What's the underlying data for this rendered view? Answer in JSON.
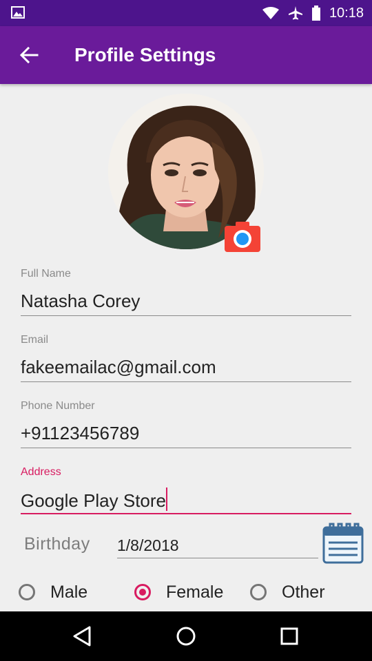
{
  "status_bar": {
    "time": "10:18",
    "icons": [
      "image-icon",
      "wifi-icon",
      "airplane-icon",
      "battery-icon"
    ]
  },
  "app_bar": {
    "title": "Profile Settings",
    "back_icon": "arrow-back-icon"
  },
  "profile": {
    "camera_icon": "camera-icon"
  },
  "form": {
    "full_name": {
      "label": "Full Name",
      "value": "Natasha Corey"
    },
    "email": {
      "label": "Email",
      "value": "fakeemailac@gmail.com"
    },
    "phone": {
      "label": "Phone Number",
      "value": "+91123456789"
    },
    "address": {
      "label": "Address",
      "value": "Google Play Store"
    },
    "birthday": {
      "label": "Birthday",
      "value": "1/8/2018",
      "calendar_icon": "calendar-icon"
    },
    "gender": {
      "options": [
        "Male",
        "Female",
        "Other"
      ],
      "selected": "Female"
    }
  },
  "nav_bar": {
    "icons": [
      "back-triangle-icon",
      "home-circle-icon",
      "recents-square-icon"
    ]
  },
  "colors": {
    "status_bar": "#4d148c",
    "app_bar": "#6a1b9a",
    "accent": "#d81b60",
    "camera": "#f44336",
    "calendar": "#3f6e9b"
  }
}
